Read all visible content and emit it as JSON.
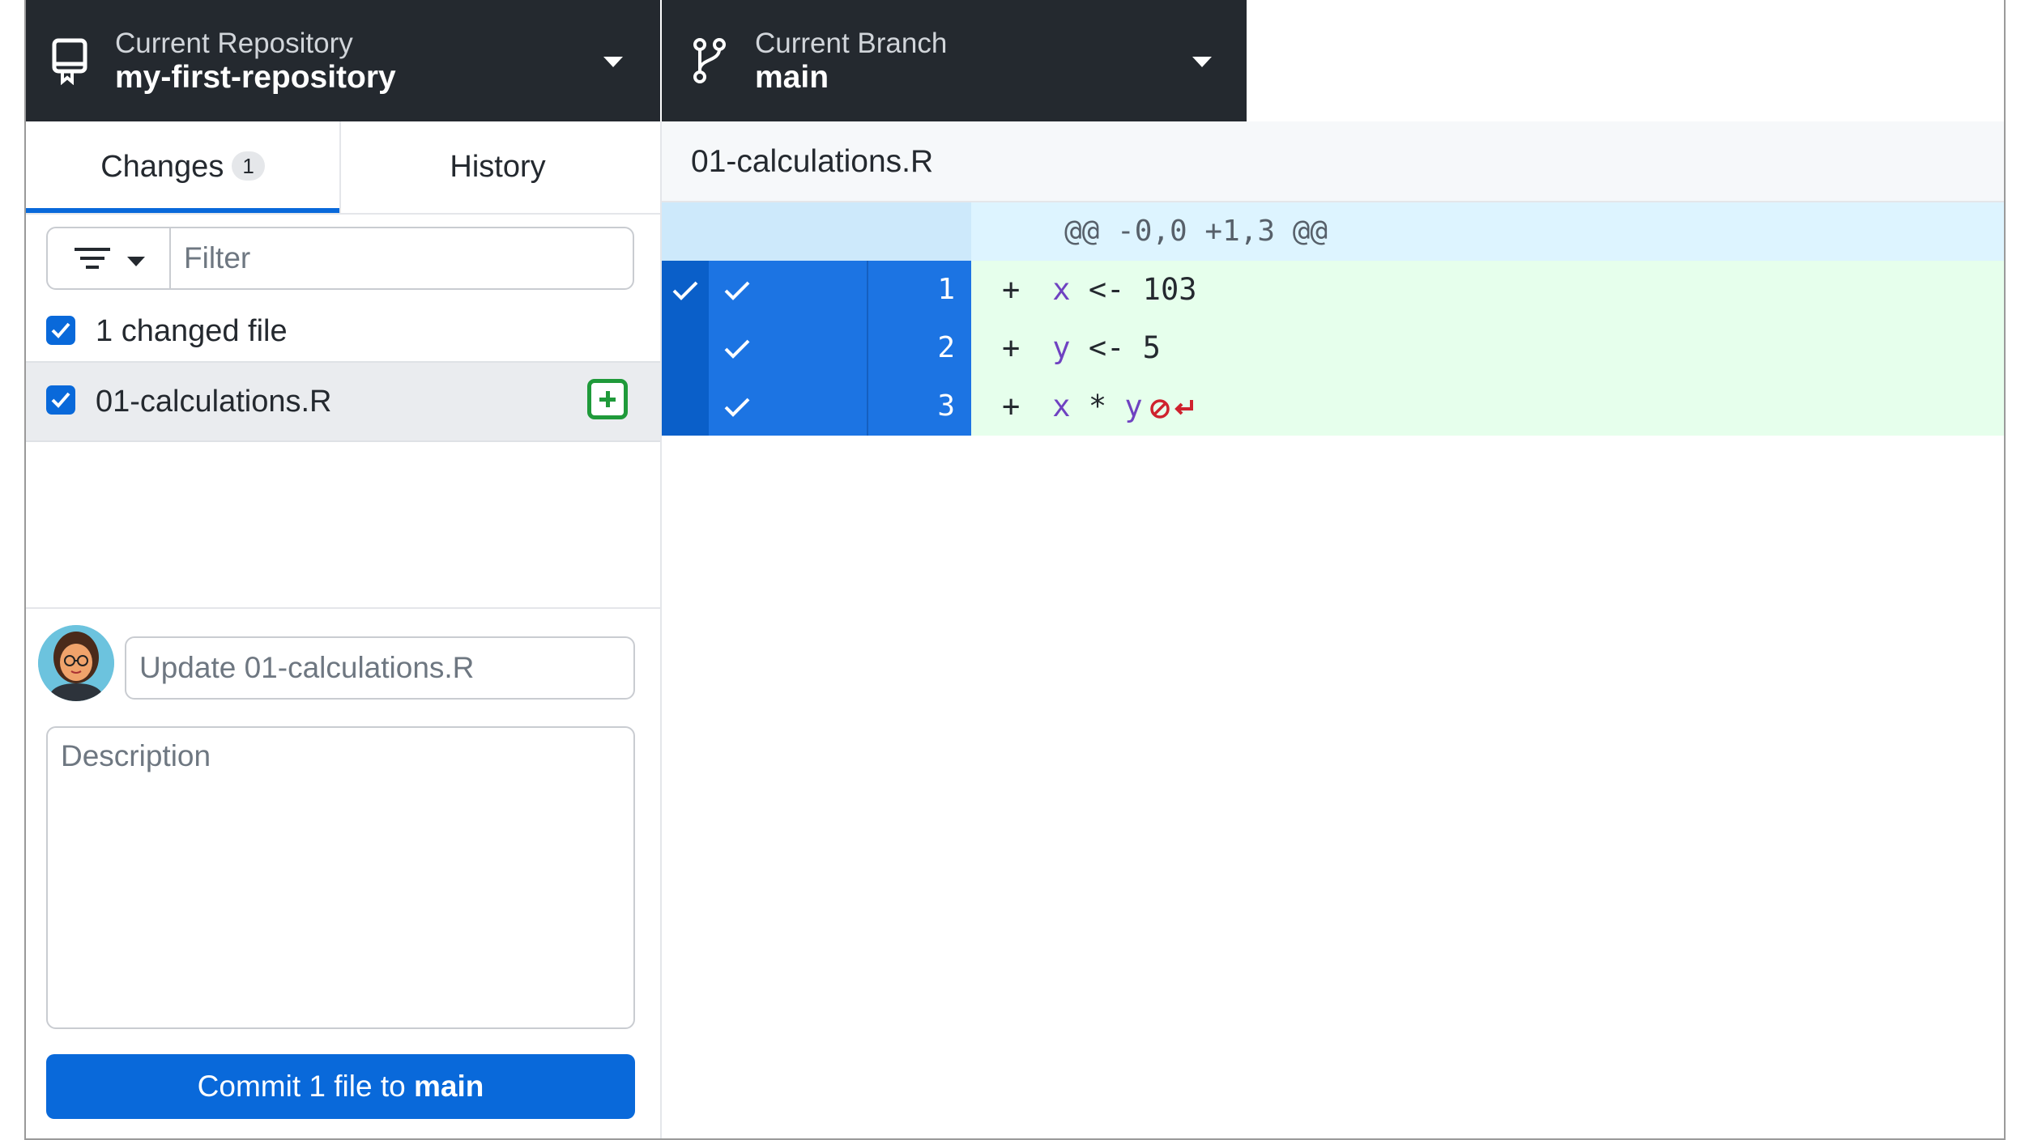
{
  "toolbar": {
    "repository_label": "Current Repository",
    "repository_name": "my-first-repository",
    "branch_label": "Current Branch",
    "branch_name": "main"
  },
  "sidebar": {
    "tabs": [
      {
        "label": "Changes",
        "badge": "1"
      },
      {
        "label": "History"
      }
    ],
    "filter_placeholder": "Filter",
    "changed_files_label": "1 changed file",
    "files": [
      {
        "name": "01-calculations.R",
        "status": "added",
        "checked": true
      }
    ]
  },
  "commit": {
    "summary_placeholder": "Update 01-calculations.R",
    "description_placeholder": "Description",
    "button_prefix": "Commit 1 file to ",
    "button_branch": "main"
  },
  "diff": {
    "file_name": "01-calculations.R",
    "hunk_header": "@@ -0,0 +1,3 @@",
    "lines": [
      {
        "number": "1",
        "sign": "+",
        "var": "x",
        "rest": " <- 103"
      },
      {
        "number": "2",
        "sign": "+",
        "var": "y",
        "rest": " <- 5"
      },
      {
        "number": "3",
        "sign": "+",
        "var": "x",
        "mid": " * ",
        "var2": "y",
        "no_newline": true
      }
    ]
  },
  "colors": {
    "toolbar_bg": "#24292f",
    "accent_blue": "#0969da",
    "added_green": "#1f9a3a",
    "added_line_bg": "#e6ffec",
    "hunk_bg": "#ddf4ff"
  }
}
